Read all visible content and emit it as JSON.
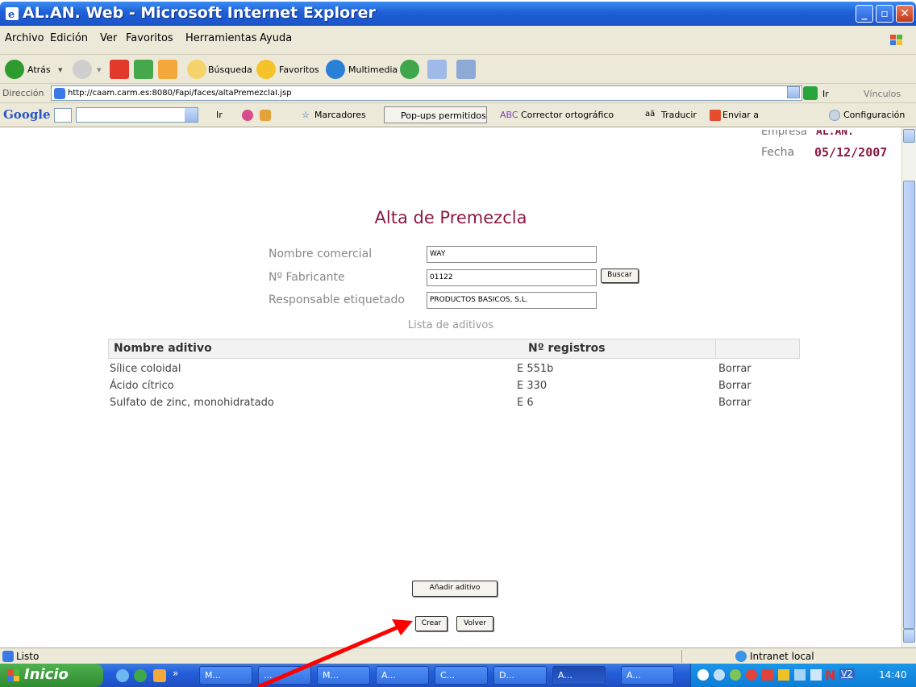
{
  "window": {
    "title": "AL.AN. Web - Microsoft Internet Explorer"
  },
  "menu": [
    "Archivo",
    "Edición",
    "Ver",
    "Favoritos",
    "Herramientas",
    "Ayuda"
  ],
  "toolbar": {
    "back": "Atrás",
    "search": "Búsqueda",
    "favorites": "Favoritos",
    "media": "Multimedia"
  },
  "address": {
    "label": "Dirección",
    "url": "http://caam.carm.es:8080/Fapi/faces/altaPremezclaI.jsp",
    "go": "Ir",
    "links": "Vínculos"
  },
  "googlebar": {
    "logo": "Google",
    "go": "Ir",
    "bookmarks": "Marcadores",
    "popups": "Pop-ups permitidos",
    "spell": "Corrector ortográfico",
    "translate": "Traducir",
    "send": "Enviar a",
    "settings": "Configuración"
  },
  "page": {
    "empresa_label": "Empresa",
    "empresa_value": "AL.AN.",
    "fecha_label": "Fecha",
    "fecha_value": "05/12/2007",
    "title": "Alta de Premezcla",
    "nombre_comercial_label": "Nombre comercial",
    "nombre_comercial_value": "WAY",
    "fabricante_label": "Nº Fabricante",
    "fabricante_value": "01122",
    "buscar": "Buscar",
    "responsable_label": "Responsable etiquetado",
    "responsable_value": "PRODUCTOS BASICOS, S.L.",
    "list_title": "Lista de aditivos",
    "col_nombre": "Nombre aditivo",
    "col_registros": "Nº registros",
    "rows": [
      {
        "nombre": "Sílice coloidal",
        "registro": "E 551b",
        "action": "Borrar"
      },
      {
        "nombre": "Ácido cítrico",
        "registro": "E 330",
        "action": "Borrar"
      },
      {
        "nombre": "Sulfato de zinc, monohidratado",
        "registro": "E 6",
        "action": "Borrar"
      }
    ],
    "add_button": "Añadir aditivo",
    "create_button": "Crear",
    "back_button": "Volver"
  },
  "status": {
    "text": "Listo",
    "zone": "Intranet local"
  },
  "taskbar": {
    "start": "Inicio",
    "items": [
      "M...",
      "...",
      "M...",
      "A...",
      "C...",
      "D...",
      "A...",
      "A..."
    ],
    "clock": "14:40"
  }
}
